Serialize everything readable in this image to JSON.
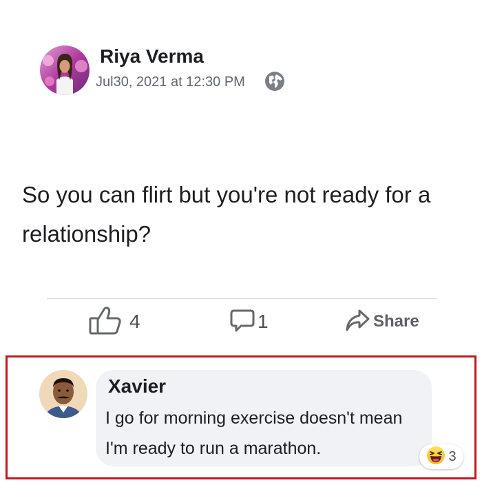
{
  "post": {
    "author": "Riya Verma",
    "timestamp": "Jul30, 2021 at 12:30 PM",
    "privacy_icon": "globe-icon",
    "text": "So you can flirt but you're not ready for a relationship?",
    "actions": {
      "like_count": "4",
      "comment_count": "1",
      "share_label": "Share"
    }
  },
  "comment": {
    "author": "Xavier",
    "text": "I go for morning exercise doesn't mean I'm ready to run a marathon.",
    "reaction_icon": "laughing-emoji-icon",
    "reaction_count": "3"
  },
  "colors": {
    "highlight_border": "#c4161c",
    "bubble_background": "#f0f2f5",
    "secondary_text": "#606770"
  }
}
